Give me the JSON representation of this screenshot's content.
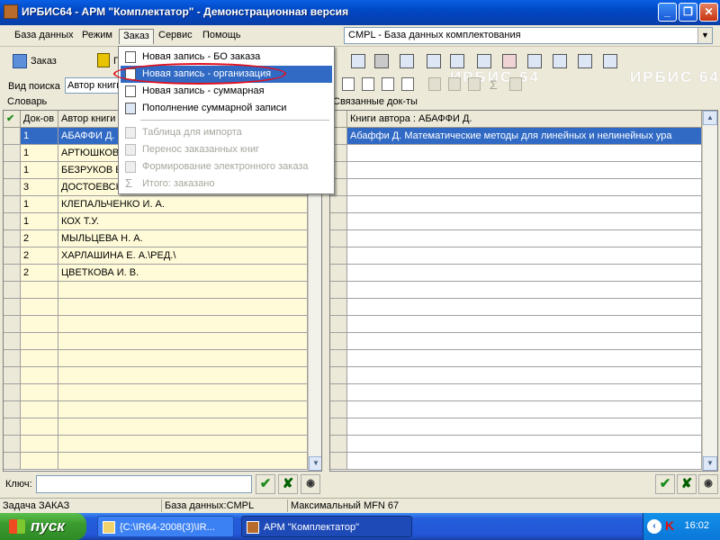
{
  "window": {
    "title": "ИРБИС64 - АРМ \"Комплектатор\" - Демонстрационная версия",
    "min": "_",
    "max": "❐",
    "close": "✕"
  },
  "menubar": {
    "items": [
      "База данных",
      "Режим",
      "Заказ",
      "Сервис",
      "Помощь"
    ],
    "database_select": "CMPL - База данных комплектования"
  },
  "toolbar": {
    "zakaz_label": "Заказ",
    "p_label": "П"
  },
  "watermark": [
    "ИРБИС 64",
    "ИРБИС 64"
  ],
  "search": {
    "label": "Вид поиска",
    "mode_value": "Автор книги"
  },
  "left_panel": {
    "label": "Словарь",
    "check_glyph": "✔",
    "columns": [
      "Док-ов",
      "Автор книги"
    ],
    "rows": [
      {
        "count": "1",
        "author": "АБАФФИ Д."
      },
      {
        "count": "1",
        "author": "АРТЮШКОВ"
      },
      {
        "count": "1",
        "author": "БЕЗРУКОВ В"
      },
      {
        "count": "3",
        "author": "ДОСТОЕВСК"
      },
      {
        "count": "1",
        "author": "КЛЕПАЛЬЧЕНКО И. А."
      },
      {
        "count": "1",
        "author": "КОХ Т.У."
      },
      {
        "count": "2",
        "author": "МЫЛЬЦЕВА Н. А."
      },
      {
        "count": "2",
        "author": "ХАРЛАШИНА Е. А.\\РЕД.\\"
      },
      {
        "count": "2",
        "author": "ЦВЕТКОВА И. В."
      }
    ]
  },
  "right_panel": {
    "label": "Связанные док-ты",
    "column": "Книги автора : АБАФФИ Д.",
    "rows": [
      "Абаффи Д. Математические методы для линейных и нелинейных ура"
    ]
  },
  "key": {
    "label": "Ключ:",
    "value": "",
    "ok": "✔",
    "cancel": "✘",
    "eye": "◉"
  },
  "statusbar": {
    "task": "Задача ЗАКАЗ",
    "database": "База данных:CMPL",
    "mfn": "Максимальный MFN 67"
  },
  "taskbar": {
    "start": "пуск",
    "items": [
      "{C:\\IR64-2008(3)\\IR...",
      "АРМ \"Комплектатор\""
    ],
    "clock": "16:02",
    "tray_k": "K"
  },
  "dropdown": {
    "items": [
      {
        "label": "Новая запись - БО заказа",
        "state": "normal"
      },
      {
        "label": "Новая запись - организация",
        "state": "highlighted"
      },
      {
        "label": "Новая запись - суммарная",
        "state": "normal"
      },
      {
        "label": "Пополнение суммарной записи",
        "state": "normal"
      },
      {
        "label": "Таблица для импорта",
        "state": "disabled"
      },
      {
        "label": "Перенос заказанных книг",
        "state": "disabled"
      },
      {
        "label": "Формирование электронного заказа",
        "state": "disabled"
      },
      {
        "label": "Итого: заказано",
        "state": "disabled"
      }
    ]
  },
  "colors": {
    "selection": "#316ac5",
    "grid_yellow": "#fffbd8",
    "annotation_oval": "#e0101e"
  }
}
